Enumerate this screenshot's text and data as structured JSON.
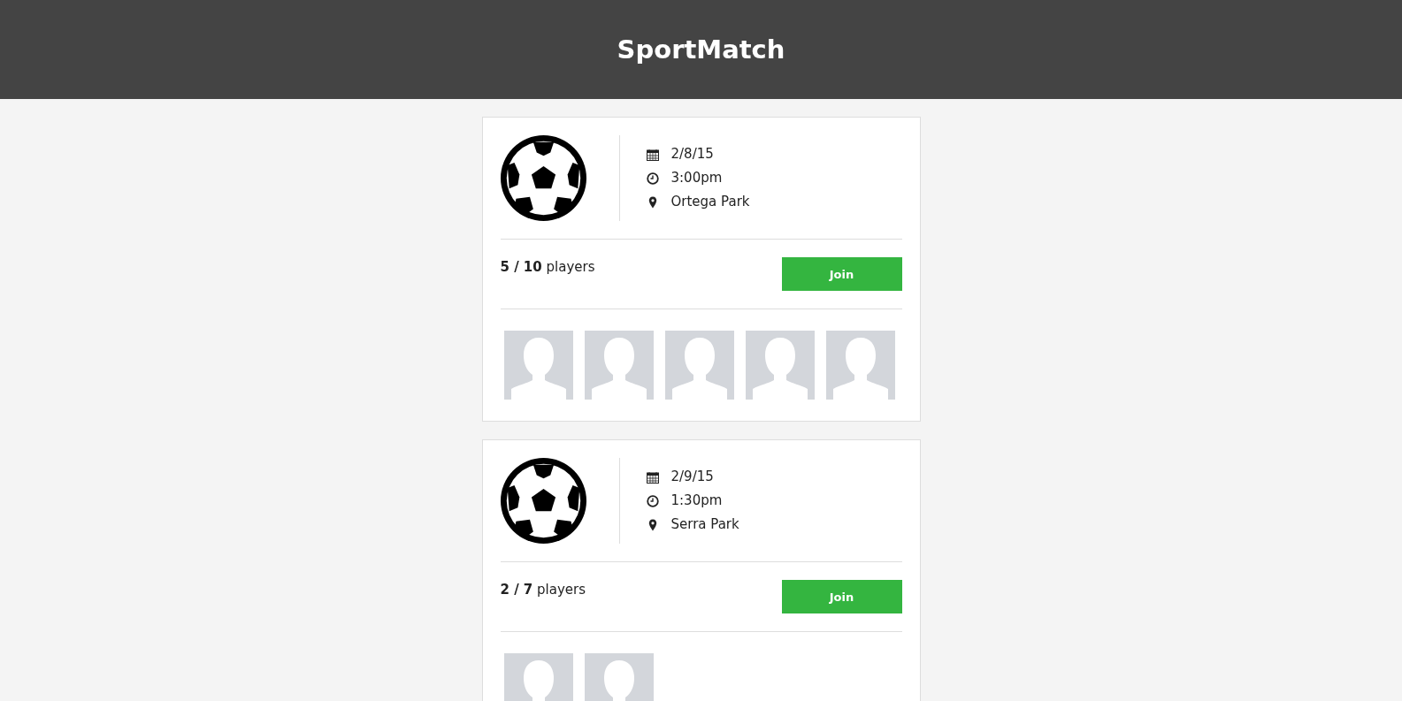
{
  "header": {
    "title": "SportMatch"
  },
  "games": [
    {
      "date": "2/8/15",
      "time": "3:00pm",
      "place": "Ortega Park",
      "players": "**5 / 10** players",
      "button": "Join",
      "avatars": [
        {
          "kind": "silhouette"
        },
        {
          "kind": "silhouette"
        },
        {
          "kind": "silhouette"
        },
        {
          "kind": "silhouette"
        },
        {
          "kind": "silhouette"
        }
      ]
    },
    {
      "date": "2/9/15",
      "time": "1:30pm",
      "place": "Serra Park",
      "players": "**2 / 7** players",
      "button": "Join",
      "avatars": [
        {
          "kind": "silhouette"
        },
        {
          "kind": "silhouette"
        }
      ]
    }
  ]
}
